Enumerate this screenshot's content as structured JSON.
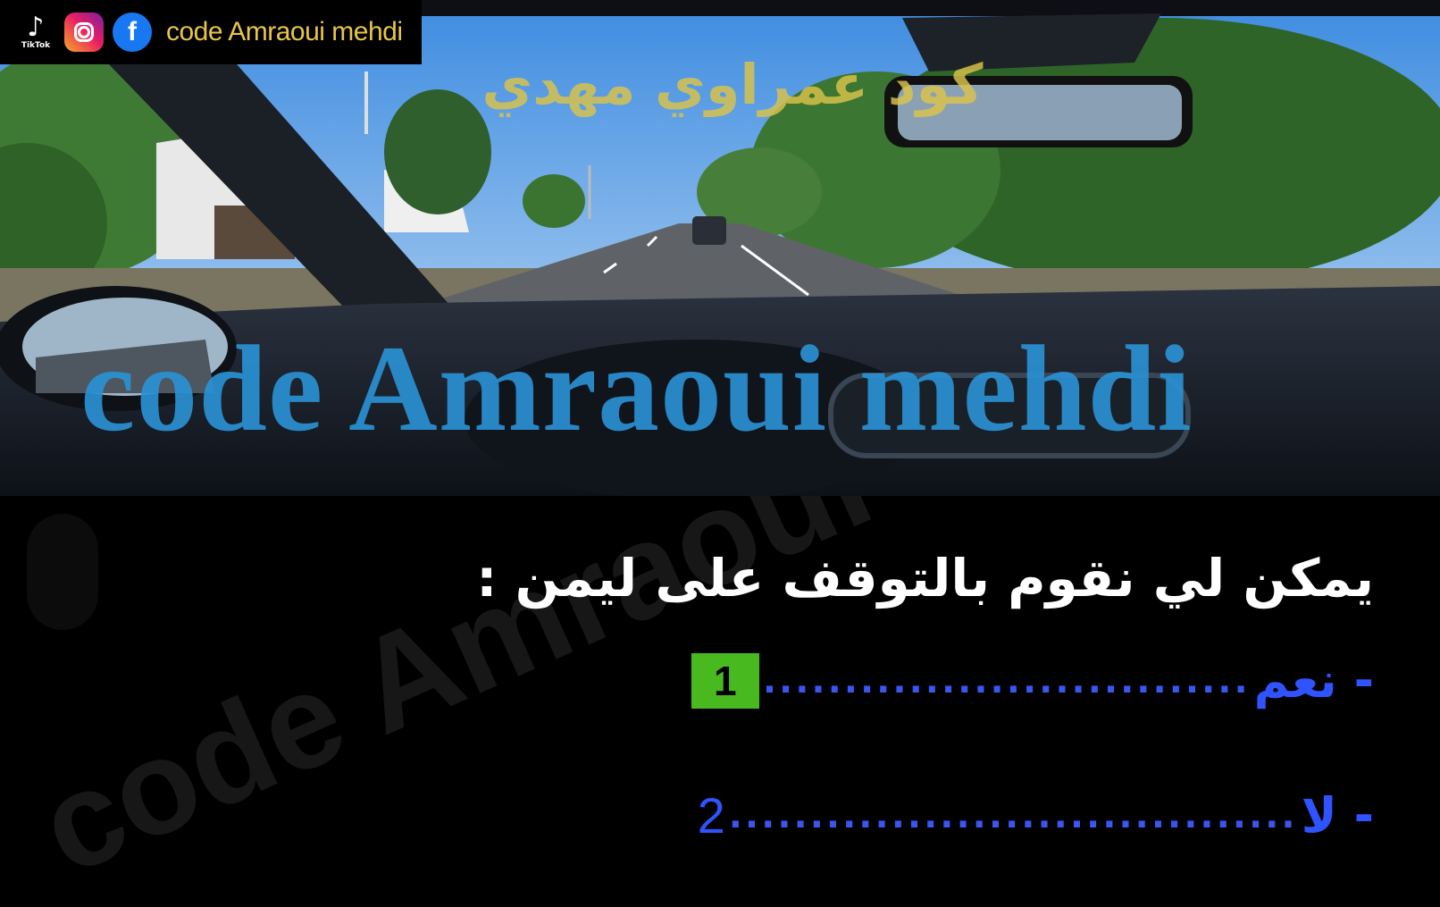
{
  "header": {
    "channel_name": "code Amraoui mehdi",
    "tiktok_label": "TikTok",
    "facebook_glyph": "f"
  },
  "watermarks": {
    "arabic_brand": "كود عمراوي مهدي",
    "big_latin": "code Amraoui mehdi",
    "faint_diagonal": "code Amraoui mehdi"
  },
  "quiz": {
    "question": "يمكن لي نقوم بالتوقف على ليمن :",
    "answers": [
      {
        "label": "- نعم",
        "dots": "..............................",
        "number": "1",
        "selected": true
      },
      {
        "label": "- لا",
        "dots": "...................................",
        "number": "2",
        "selected": false
      }
    ]
  },
  "colors": {
    "answer_text": "#2f53ff",
    "selected_box": "#48b91e",
    "brand_gold": "#dcc44a",
    "watermark_blue": "#2a93d6"
  },
  "icons": [
    "tiktok-icon",
    "instagram-icon",
    "facebook-icon"
  ]
}
